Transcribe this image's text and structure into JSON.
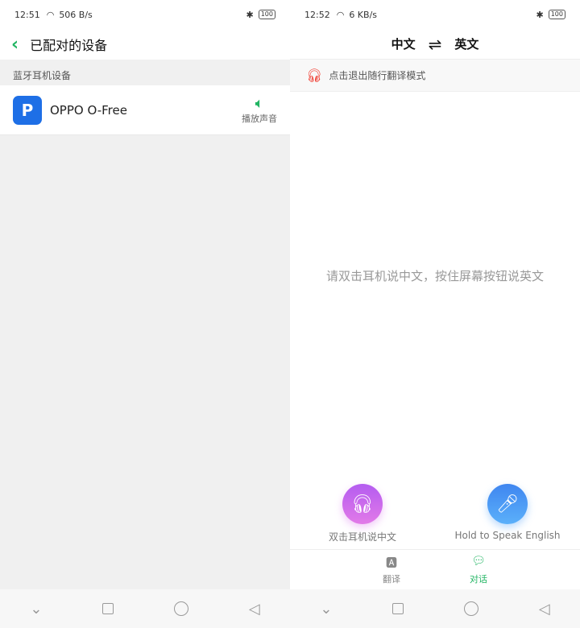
{
  "left": {
    "status": {
      "time": "12:51",
      "speed": "506 B/s",
      "battery": "100"
    },
    "header": {
      "title": "已配对的设备"
    },
    "section": "蓝牙耳机设备",
    "device": {
      "name": "OPPO O-Free",
      "action": "播放声音",
      "icon": "speaker-icon"
    }
  },
  "right": {
    "status": {
      "time": "12:52",
      "speed": "6 KB/s",
      "battery": "100"
    },
    "header": {
      "source": "中文",
      "swap": "⇌",
      "target": "英文"
    },
    "banner": "点击退出随行翻译模式",
    "hint": "请双击耳机说中文，按住屏幕按钮说英文",
    "buttons": [
      {
        "label": "双击耳机说中文",
        "color": "#c466ee"
      },
      {
        "label": "Hold to Speak English",
        "color": "#4a9af5"
      }
    ],
    "tabs": [
      {
        "label": "翻译"
      },
      {
        "label": "对话",
        "active": true
      }
    ],
    "accent": "#22b563"
  }
}
